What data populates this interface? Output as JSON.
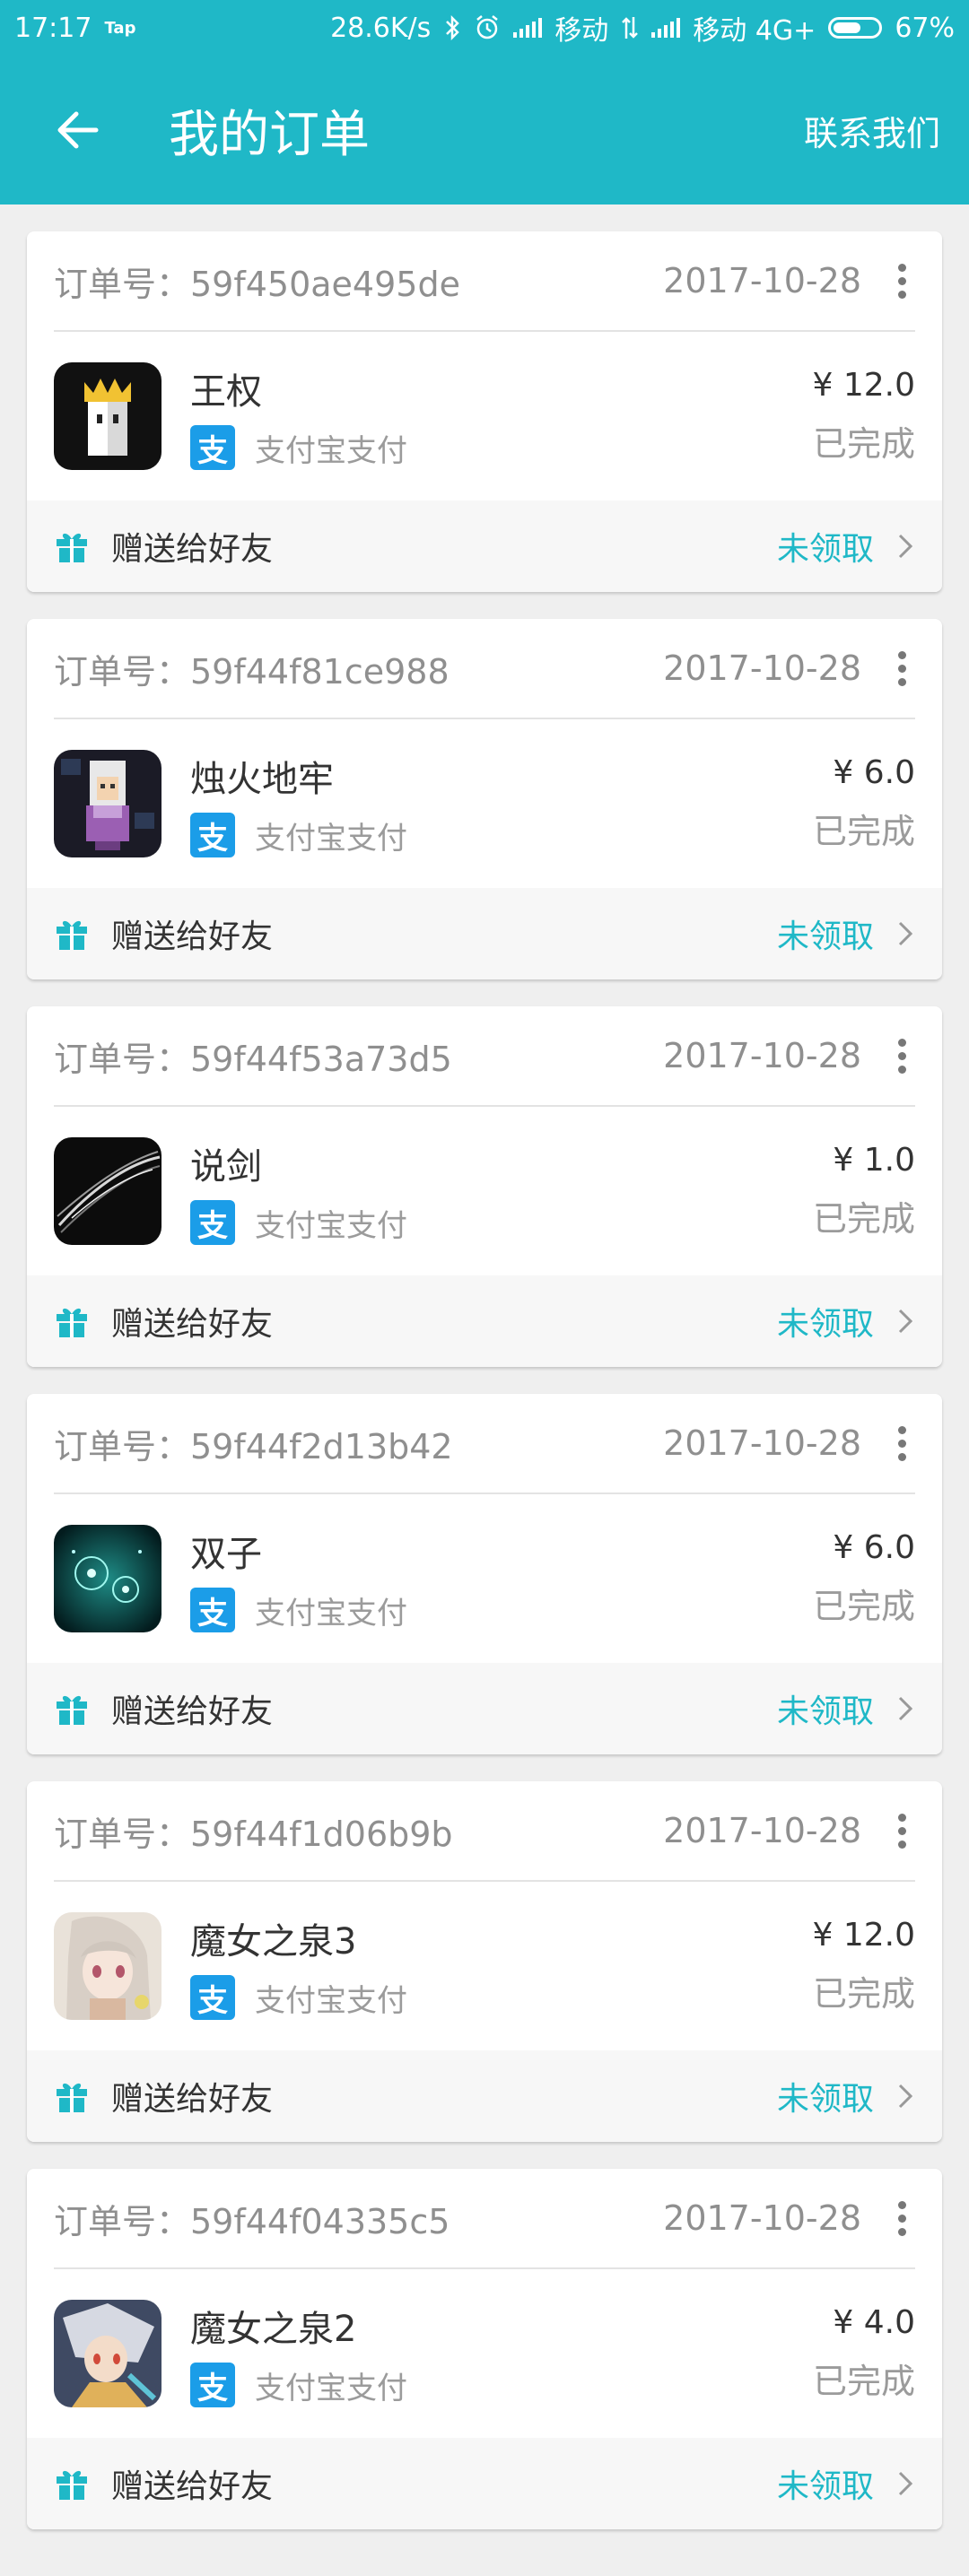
{
  "status_bar": {
    "time": "17:17",
    "tap": "Tap",
    "speed": "28.6K/s",
    "carrier1": "移动",
    "carrier2": "移动 4G+",
    "battery": "67%",
    "battery_level": 0.67
  },
  "header": {
    "title": "我的订单",
    "contact": "联系我们"
  },
  "labels": {
    "payment": "支付宝支付",
    "alipay_glyph": "支",
    "gift": "赠送给好友",
    "claim": "未领取"
  },
  "orders": [
    {
      "order_no": "订单号：59f450ae495de",
      "date": "2017-10-28",
      "name": "王权",
      "price": "¥ 12.0",
      "status": "已完成",
      "icon": "reigns-icon"
    },
    {
      "order_no": "订单号：59f44f81ce988",
      "date": "2017-10-28",
      "name": "烛火地牢",
      "price": "¥ 6.0",
      "status": "已完成",
      "icon": "candle-dungeon-icon"
    },
    {
      "order_no": "订单号：59f44f53a73d5",
      "date": "2017-10-28",
      "name": "说剑",
      "price": "¥ 1.0",
      "status": "已完成",
      "icon": "sword-icon"
    },
    {
      "order_no": "订单号：59f44f2d13b42",
      "date": "2017-10-28",
      "name": "双子",
      "price": "¥ 6.0",
      "status": "已完成",
      "icon": "twins-icon"
    },
    {
      "order_no": "订单号：59f44f1d06b9b",
      "date": "2017-10-28",
      "name": "魔女之泉3",
      "price": "¥ 12.0",
      "status": "已完成",
      "icon": "witch-spring-3-icon"
    },
    {
      "order_no": "订单号：59f44f04335c5",
      "date": "2017-10-28",
      "name": "魔女之泉2",
      "price": "¥ 4.0",
      "status": "已完成",
      "icon": "witch-spring-2-icon"
    }
  ],
  "colors": {
    "accent": "#1fb8c7",
    "alipay": "#1b9de8",
    "background": "#efefef"
  }
}
